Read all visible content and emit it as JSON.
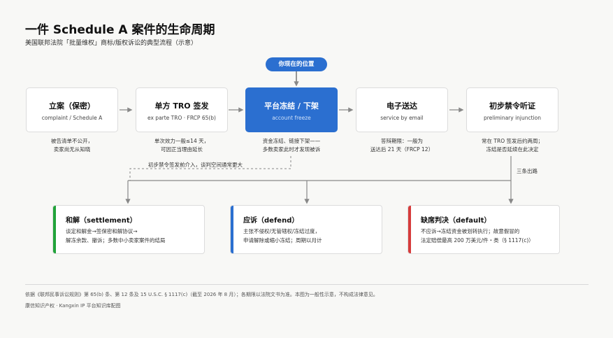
{
  "header": {
    "title": "一件 Schedule A 案件的生命周期",
    "subtitle": "美国联邦法院「批量维权」商标/版权诉讼的典型流程（示意）"
  },
  "current_position_label": "你现在的位置",
  "stages": [
    {
      "name": "立案（保密）",
      "en": "complaint / Schedule A",
      "note": [
        "被告清单不公开，",
        "卖家尚无从知晓"
      ]
    },
    {
      "name": "单方 TRO 签发",
      "en": "ex parte TRO · FRCP 65(b)",
      "note": [
        "单次效力一般≤14 天，",
        "可因正当理由延长"
      ]
    },
    {
      "name": "平台冻结 / 下架",
      "en": "account freeze",
      "note": [
        "资金冻结、链接下架——",
        "多数卖家此时才发现被诉"
      ]
    },
    {
      "name": "电子送达",
      "en": "service by email",
      "note": [
        "答辩期限：一般为",
        "送达后 21 天（FRCP 12）"
      ]
    },
    {
      "name": "初步禁令听证",
      "en": "preliminary injunction",
      "note": [
        "常在 TRO 签发后约两周；",
        "冻结是否延续在此决定"
      ]
    }
  ],
  "annotations": {
    "early_settlement": "初步禁令签发前介入，谈判空间通常更大",
    "three_outcomes": "三条出路"
  },
  "outcomes": [
    {
      "name": "和解（settlement）",
      "desc": [
        "谈定和解金→签保密和解协议→",
        "解冻余款、撤诉；多数中小卖家案件的结局"
      ]
    },
    {
      "name": "应诉（defend）",
      "desc": [
        "主张不侵权/无管辖权/冻结过度，",
        "申请解除或缩小冻结；周期以月计"
      ]
    },
    {
      "name": "缺席判决（default）",
      "desc": [
        "不应诉→冻结资金被划转执行；故意假冒的",
        "法定赔偿最高 200 万美元/件・类（§ 1117(c)）"
      ]
    }
  ],
  "footer": {
    "note": "依据《联邦民事诉讼规则》第 65(b) 条、第 12 条及 15 U.S.C. § 1117(c)（截至 2026 年 8 月）；各期限以法院文书为准。本图为一般性示意，不构成法律意见。",
    "credit": "康信知识产权 · Kangxin IP 平台知识库配图"
  },
  "colors": {
    "active_stage": "#2b6fd0",
    "settlement": "#22a33a",
    "defend": "#2b6fd0",
    "default": "#d63b3b",
    "connector": "#888888"
  }
}
